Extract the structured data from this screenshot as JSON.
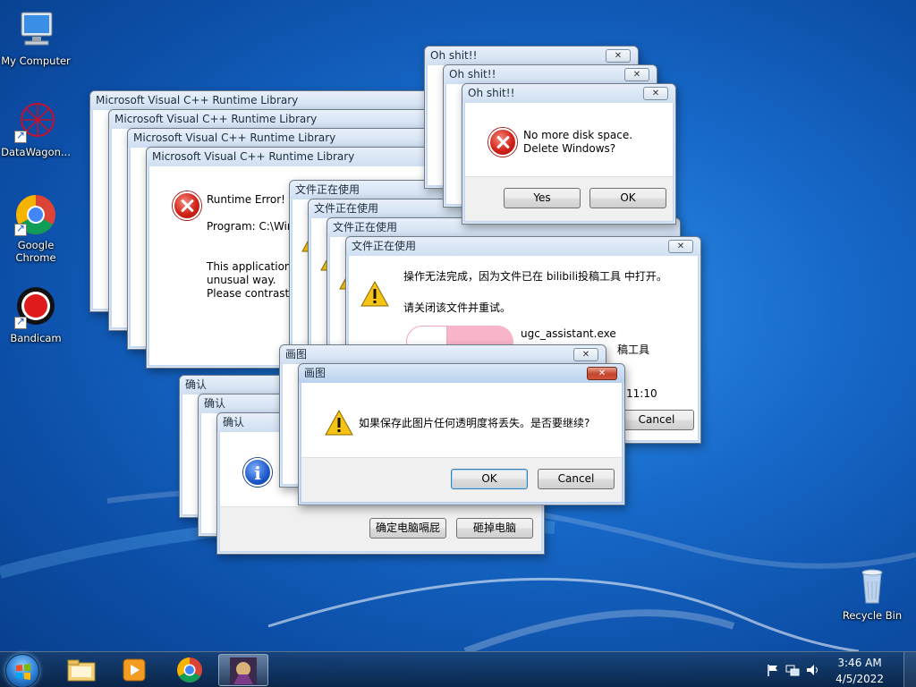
{
  "desktop_icons": [
    {
      "label": "My Computer"
    },
    {
      "label": "DataWagon..."
    },
    {
      "label": "Google Chrome"
    },
    {
      "label": "Bandicam"
    },
    {
      "label": "Recycle Bin"
    }
  ],
  "vc_runtime": {
    "title": "Microsoft Visual C++ Runtime Library",
    "line1": "Runtime Error!",
    "line2": "Program: C:\\Wind",
    "line3": "This application h",
    "line4": "unusual way.",
    "line5": "Please contrast th"
  },
  "file_in_use": {
    "title": "文件正在使用",
    "message": "操作无法完成，因为文件已在 bilibili投稿工具 中打开。",
    "hint": "请关闭该文件并重试。",
    "app_name": "ugc_assistant.exe",
    "app_desc_fragment": "稿工具",
    "time_fragment": "11:10",
    "cancel_label": "Cancel"
  },
  "oh_shit": {
    "title": "Oh shit!!",
    "line1": "No more disk space.",
    "line2": "Delete Windows?",
    "yes_label": "Yes",
    "ok_label": "OK"
  },
  "confirm": {
    "title": "确认",
    "button1": "确定电脑嗝屁",
    "button2": "砸掉电脑"
  },
  "paint": {
    "title": "画图",
    "message": "如果保存此图片任何透明度将丢失。是否要继续?",
    "ok_label": "OK",
    "cancel_label": "Cancel"
  },
  "taskbar": {
    "time": "3:46 AM",
    "date": "4/5/2022"
  }
}
